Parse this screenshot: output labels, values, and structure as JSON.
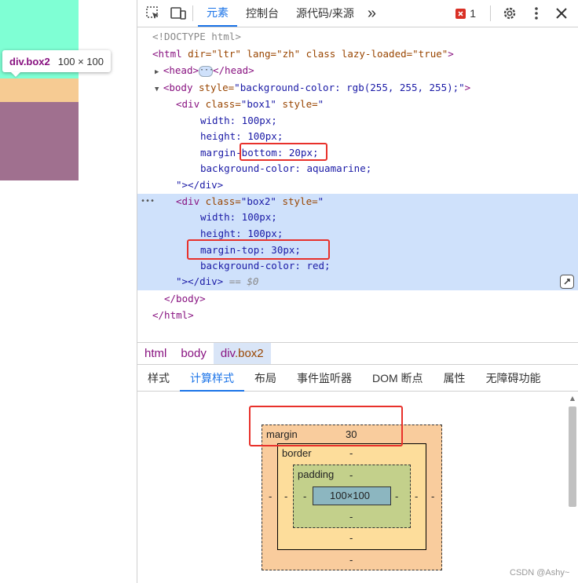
{
  "preview": {
    "tooltip_tag": "div.box2",
    "tooltip_dims": "100 × 100",
    "colors": {
      "box1": "#7fffd4",
      "margin": "#f6cb93",
      "box2": "#a0708f"
    }
  },
  "toolbar": {
    "tabs": [
      "元素",
      "控制台",
      "源代码/来源"
    ],
    "more": "»",
    "error_count": "1"
  },
  "dom": {
    "doctype": "<!DOCTYPE html>",
    "html_open": {
      "tag": "<html",
      "attrs": " dir=\"ltr\" lang=\"zh\" class lazy-loaded=\"true\"",
      "end": ">"
    },
    "head": {
      "open": "<head>",
      "close": "</head>"
    },
    "body_open": {
      "tag": "<body",
      "attr": " style=",
      "val": "\"background-color: rgb(255, 255, 255);\"",
      "end": ">"
    },
    "box1_open": {
      "tag": "<div",
      "attr": " class=",
      "val": "\"box1\"",
      "attr2": " style=",
      "val2": "\""
    },
    "box1_props": [
      "width: 100px;",
      "height: 100px;",
      "margin-bottom: 20px;",
      "background-color: aquamarine;"
    ],
    "box1_close": "\"></div>",
    "box2_open": {
      "tag": "<div",
      "attr": " class=",
      "val": "\"box2\"",
      "attr2": " style=",
      "val2": "\""
    },
    "box2_props": [
      "width: 100px;",
      "height: 100px;",
      "margin-top: 30px;",
      "background-color: red;"
    ],
    "box2_close": "\"></div>",
    "box2_marker": " == $0",
    "body_close": "</body>",
    "html_close": "</html>",
    "row_dots": "•••"
  },
  "breadcrumbs": [
    "html",
    "body"
  ],
  "breadcrumb_active": {
    "tag": "div",
    "cls": ".box2"
  },
  "subtabs": [
    "样式",
    "计算样式",
    "布局",
    "事件监听器",
    "DOM 断点",
    "属性",
    "无障碍功能"
  ],
  "box_model": {
    "margin_label": "margin",
    "margin_top": "30",
    "margin_right": "-",
    "margin_bottom": "-",
    "margin_left": "-",
    "border_label": "border",
    "border_top": "-",
    "border_right": "-",
    "border_bottom": "-",
    "border_left": "-",
    "padding_label": "padding",
    "padding_top": "-",
    "padding_right": "-",
    "padding_bottom": "-",
    "padding_left": "-",
    "content": "100×100"
  },
  "watermark": "CSDN @Ashy~"
}
